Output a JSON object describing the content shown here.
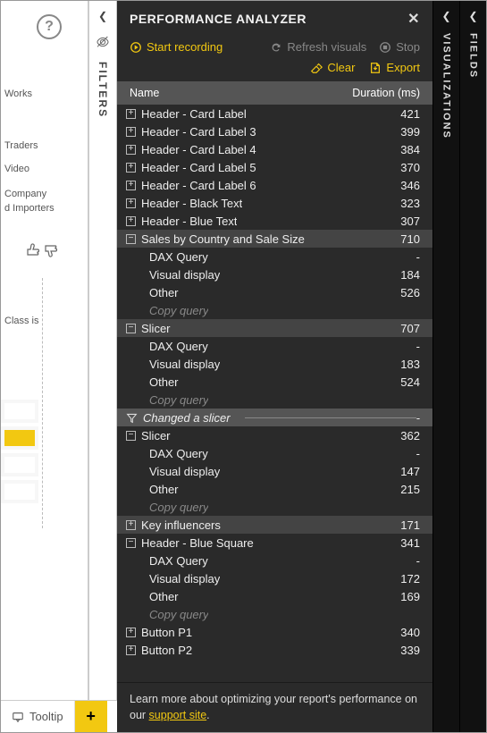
{
  "header": {
    "title": "PERFORMANCE ANALYZER"
  },
  "toolbar": {
    "start": "Start recording",
    "refresh": "Refresh visuals",
    "stop": "Stop",
    "clear": "Clear",
    "export": "Export"
  },
  "table": {
    "col_name": "Name",
    "col_duration": "Duration (ms)"
  },
  "rows": [
    {
      "kind": "parent",
      "state": "plus",
      "name": "Header - Card Label",
      "dur": "421"
    },
    {
      "kind": "parent",
      "state": "plus",
      "name": "Header - Card Label 3",
      "dur": "399"
    },
    {
      "kind": "parent",
      "state": "plus",
      "name": "Header - Card Label 4",
      "dur": "384"
    },
    {
      "kind": "parent",
      "state": "plus",
      "name": "Header - Card Label 5",
      "dur": "370"
    },
    {
      "kind": "parent",
      "state": "plus",
      "name": "Header - Card Label 6",
      "dur": "346"
    },
    {
      "kind": "parent",
      "state": "plus",
      "name": "Header - Black Text",
      "dur": "323"
    },
    {
      "kind": "parent",
      "state": "plus",
      "name": "Header - Blue Text",
      "dur": "307"
    },
    {
      "kind": "parent",
      "state": "minus",
      "name": "Sales by Country and Sale Size",
      "dur": "710",
      "hl": true
    },
    {
      "kind": "child",
      "name": "DAX Query",
      "dur": "-"
    },
    {
      "kind": "child",
      "name": "Visual display",
      "dur": "184"
    },
    {
      "kind": "child",
      "name": "Other",
      "dur": "526"
    },
    {
      "kind": "copy",
      "name": "Copy query"
    },
    {
      "kind": "parent",
      "state": "minus",
      "name": "Slicer",
      "dur": "707",
      "hl": true
    },
    {
      "kind": "child",
      "name": "DAX Query",
      "dur": "-"
    },
    {
      "kind": "child",
      "name": "Visual display",
      "dur": "183"
    },
    {
      "kind": "child",
      "name": "Other",
      "dur": "524"
    },
    {
      "kind": "copy",
      "name": "Copy query"
    },
    {
      "kind": "event",
      "name": "Changed a slicer",
      "dur": "-"
    },
    {
      "kind": "parent",
      "state": "minus",
      "name": "Slicer",
      "dur": "362"
    },
    {
      "kind": "child",
      "name": "DAX Query",
      "dur": "-"
    },
    {
      "kind": "child",
      "name": "Visual display",
      "dur": "147"
    },
    {
      "kind": "child",
      "name": "Other",
      "dur": "215"
    },
    {
      "kind": "copy",
      "name": "Copy query"
    },
    {
      "kind": "parent",
      "state": "plus",
      "name": "Key influencers",
      "dur": "171",
      "hl": true
    },
    {
      "kind": "parent",
      "state": "minus",
      "name": "Header - Blue Square",
      "dur": "341"
    },
    {
      "kind": "child",
      "name": "DAX Query",
      "dur": "-"
    },
    {
      "kind": "child",
      "name": "Visual display",
      "dur": "172"
    },
    {
      "kind": "child",
      "name": "Other",
      "dur": "169"
    },
    {
      "kind": "copy",
      "name": "Copy query"
    },
    {
      "kind": "parent",
      "state": "plus",
      "name": "Button P1",
      "dur": "340"
    },
    {
      "kind": "parent",
      "state": "plus",
      "name": "Button P2",
      "dur": "339"
    }
  ],
  "footer": {
    "text_a": "Learn more about optimizing your report's performance on our ",
    "link": "support site",
    "text_b": "."
  },
  "tabs": {
    "tooltip": "Tooltip"
  },
  "panes": {
    "filters": "FILTERS",
    "visualizations": "VISUALIZATIONS",
    "fields": "FIELDS"
  },
  "canvas": {
    "t1": "Works",
    "t2": "Traders",
    "t3": " Video",
    "t4": "Company",
    "t5": "d Importers",
    "t6": "Class is"
  }
}
